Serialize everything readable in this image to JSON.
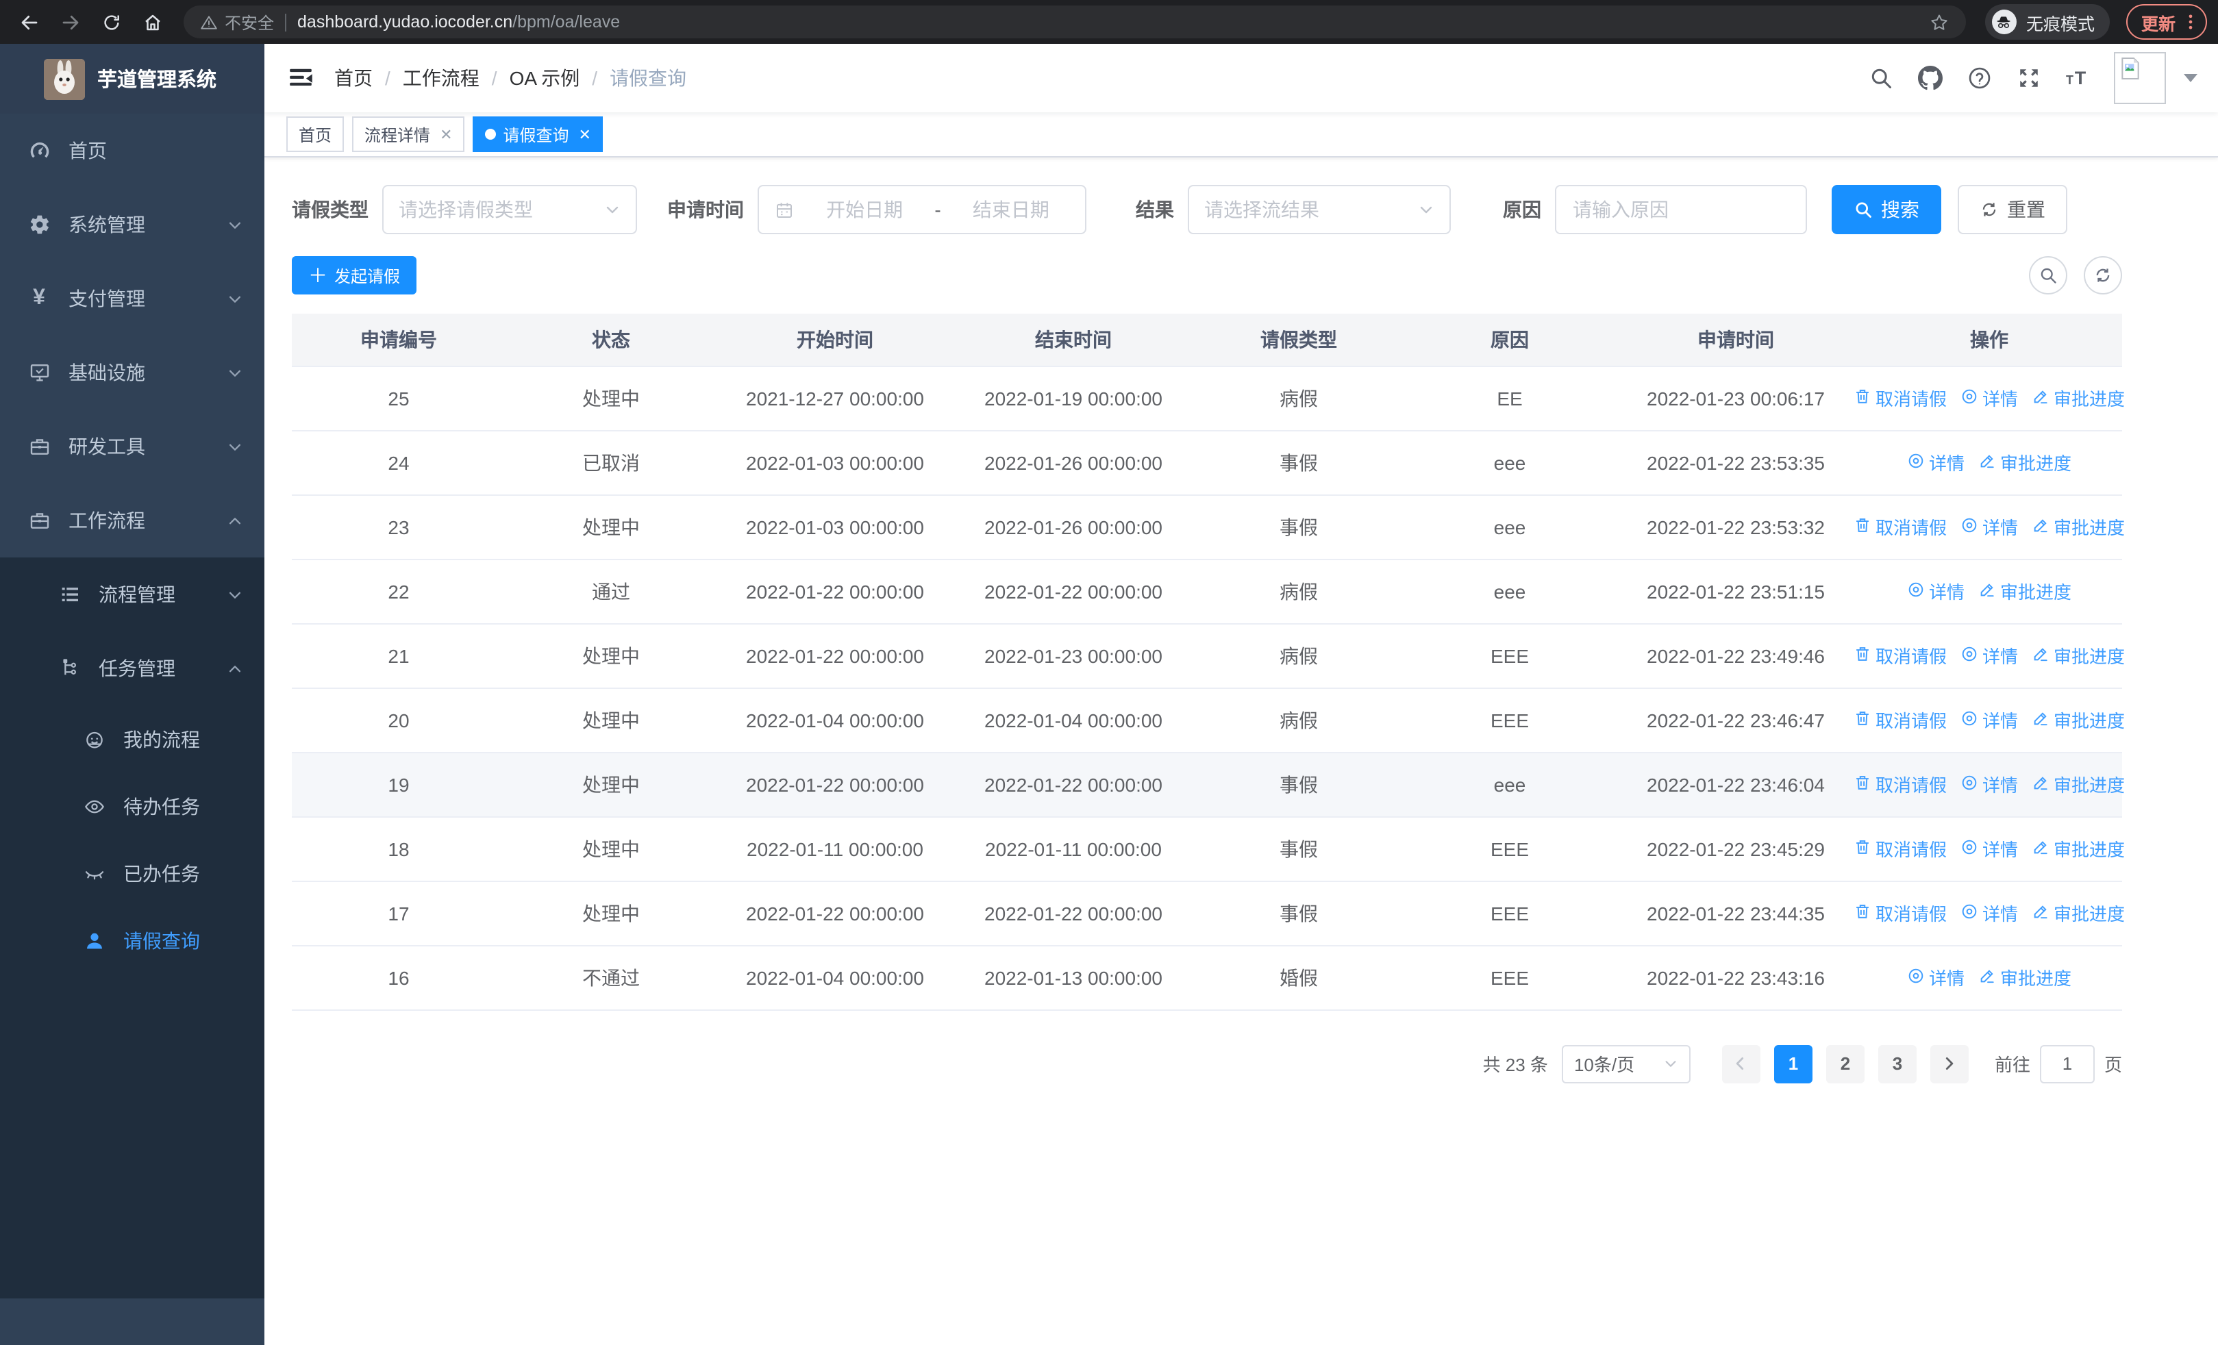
{
  "browser": {
    "security_warning": "不安全",
    "url_host": "dashboard.yudao.iocoder.cn",
    "url_path": "/bpm/oa/leave",
    "incognito_label": "无痕模式",
    "update_label": "更新"
  },
  "sidebar": {
    "app_title": "芋道管理系统",
    "menu": [
      {
        "key": "home",
        "label": "首页",
        "icon": "dashboard-icon",
        "level": 1
      },
      {
        "key": "system",
        "label": "系统管理",
        "icon": "gear-icon",
        "level": 1,
        "chevron": "down"
      },
      {
        "key": "payment",
        "label": "支付管理",
        "icon": "yen-icon",
        "level": 1,
        "chevron": "down"
      },
      {
        "key": "infrastructure",
        "label": "基础设施",
        "icon": "monitor-icon",
        "level": 1,
        "chevron": "down"
      },
      {
        "key": "dev-tools",
        "label": "研发工具",
        "icon": "toolbox-icon",
        "level": 1,
        "chevron": "down"
      },
      {
        "key": "workflow",
        "label": "工作流程",
        "icon": "briefcase-icon",
        "level": 1,
        "chevron": "up"
      },
      {
        "key": "process-mgmt",
        "label": "流程管理",
        "icon": "list-icon",
        "level": 2,
        "chevron": "down"
      },
      {
        "key": "task-mgmt",
        "label": "任务管理",
        "icon": "tree-icon",
        "level": 2,
        "chevron": "up"
      },
      {
        "key": "my-process",
        "label": "我的流程",
        "icon": "robot-icon",
        "level": 3
      },
      {
        "key": "todo-tasks",
        "label": "待办任务",
        "icon": "eye-icon",
        "level": 3
      },
      {
        "key": "done-tasks",
        "label": "已办任务",
        "icon": "eye-closed-icon",
        "level": 3
      },
      {
        "key": "leave-query",
        "label": "请假查询",
        "icon": "user-icon",
        "level": 3,
        "active": true
      }
    ]
  },
  "navbar": {
    "breadcrumb": [
      "首页",
      "工作流程",
      "OA 示例",
      "请假查询"
    ]
  },
  "tabs": [
    {
      "key": "home",
      "label": "首页",
      "closable": false,
      "active": false
    },
    {
      "key": "process-detail",
      "label": "流程详情",
      "closable": true,
      "active": false
    },
    {
      "key": "leave-query",
      "label": "请假查询",
      "closable": true,
      "active": true
    }
  ],
  "filters": {
    "leave_type_label": "请假类型",
    "leave_type_placeholder": "请选择请假类型",
    "apply_time_label": "申请时间",
    "start_date_placeholder": "开始日期",
    "date_separator": "-",
    "end_date_placeholder": "结束日期",
    "result_label": "结果",
    "result_placeholder": "请选择流结果",
    "reason_label": "原因",
    "reason_placeholder": "请输入原因",
    "search_label": "搜索",
    "reset_label": "重置"
  },
  "toolbar": {
    "create_label": "发起请假"
  },
  "table": {
    "headers": [
      "申请编号",
      "状态",
      "开始时间",
      "结束时间",
      "请假类型",
      "原因",
      "申请时间",
      "操作"
    ],
    "action_labels": {
      "cancel": "取消请假",
      "detail": "详情",
      "progress": "审批进度"
    },
    "rows": [
      {
        "id": "25",
        "status": "处理中",
        "start": "2021-12-27 00:00:00",
        "end": "2022-01-19 00:00:00",
        "type": "病假",
        "reason": "EE",
        "applied": "2022-01-23 00:06:17",
        "actions": [
          "cancel",
          "detail",
          "progress"
        ],
        "hovered": false
      },
      {
        "id": "24",
        "status": "已取消",
        "start": "2022-01-03 00:00:00",
        "end": "2022-01-26 00:00:00",
        "type": "事假",
        "reason": "eee",
        "applied": "2022-01-22 23:53:35",
        "actions": [
          "detail",
          "progress"
        ],
        "hovered": false
      },
      {
        "id": "23",
        "status": "处理中",
        "start": "2022-01-03 00:00:00",
        "end": "2022-01-26 00:00:00",
        "type": "事假",
        "reason": "eee",
        "applied": "2022-01-22 23:53:32",
        "actions": [
          "cancel",
          "detail",
          "progress"
        ],
        "hovered": false
      },
      {
        "id": "22",
        "status": "通过",
        "start": "2022-01-22 00:00:00",
        "end": "2022-01-22 00:00:00",
        "type": "病假",
        "reason": "eee",
        "applied": "2022-01-22 23:51:15",
        "actions": [
          "detail",
          "progress"
        ],
        "hovered": false
      },
      {
        "id": "21",
        "status": "处理中",
        "start": "2022-01-22 00:00:00",
        "end": "2022-01-23 00:00:00",
        "type": "病假",
        "reason": "EEE",
        "applied": "2022-01-22 23:49:46",
        "actions": [
          "cancel",
          "detail",
          "progress"
        ],
        "hovered": false
      },
      {
        "id": "20",
        "status": "处理中",
        "start": "2022-01-04 00:00:00",
        "end": "2022-01-04 00:00:00",
        "type": "病假",
        "reason": "EEE",
        "applied": "2022-01-22 23:46:47",
        "actions": [
          "cancel",
          "detail",
          "progress"
        ],
        "hovered": false
      },
      {
        "id": "19",
        "status": "处理中",
        "start": "2022-01-22 00:00:00",
        "end": "2022-01-22 00:00:00",
        "type": "事假",
        "reason": "eee",
        "applied": "2022-01-22 23:46:04",
        "actions": [
          "cancel",
          "detail",
          "progress"
        ],
        "hovered": true
      },
      {
        "id": "18",
        "status": "处理中",
        "start": "2022-01-11 00:00:00",
        "end": "2022-01-11 00:00:00",
        "type": "事假",
        "reason": "EEE",
        "applied": "2022-01-22 23:45:29",
        "actions": [
          "cancel",
          "detail",
          "progress"
        ],
        "hovered": false
      },
      {
        "id": "17",
        "status": "处理中",
        "start": "2022-01-22 00:00:00",
        "end": "2022-01-22 00:00:00",
        "type": "事假",
        "reason": "EEE",
        "applied": "2022-01-22 23:44:35",
        "actions": [
          "cancel",
          "detail",
          "progress"
        ],
        "hovered": false
      },
      {
        "id": "16",
        "status": "不通过",
        "start": "2022-01-04 00:00:00",
        "end": "2022-01-13 00:00:00",
        "type": "婚假",
        "reason": "EEE",
        "applied": "2022-01-22 23:43:16",
        "actions": [
          "detail",
          "progress"
        ],
        "hovered": false
      }
    ]
  },
  "pagination": {
    "total_label": "共 23 条",
    "page_size": "10条/页",
    "pages": [
      "1",
      "2",
      "3"
    ],
    "current": "1",
    "goto_label": "前往",
    "goto_value": "1",
    "page_unit": "页"
  },
  "colors": {
    "primary": "#1890ff",
    "link": "#409eff",
    "sidebar": "#304156",
    "submenu": "#1f2d3d",
    "update_badge": "#f28b82"
  }
}
